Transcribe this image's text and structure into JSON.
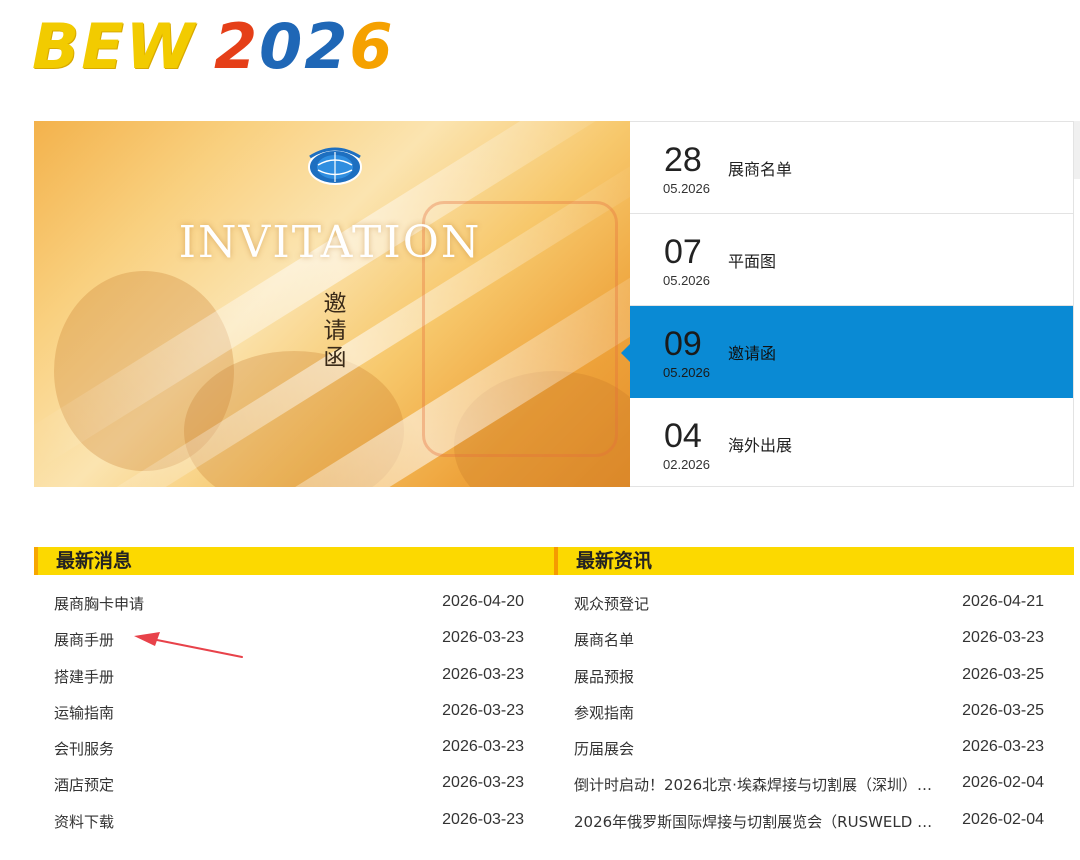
{
  "logo": {
    "bew": "BEW",
    "year_digits": [
      "2",
      "0",
      "2",
      "6"
    ]
  },
  "banner": {
    "title": "INVITATION",
    "subtitle": "邀请函"
  },
  "dates": [
    {
      "day": "28",
      "month_year": "05.2026",
      "title": "展商名单",
      "active": false
    },
    {
      "day": "07",
      "month_year": "05.2026",
      "title": "平面图",
      "active": false
    },
    {
      "day": "09",
      "month_year": "05.2026",
      "title": "邀请函",
      "active": true
    },
    {
      "day": "04",
      "month_year": "02.2026",
      "title": "海外出展",
      "active": false
    }
  ],
  "left_column": {
    "title": "最新消息",
    "items": [
      {
        "title": "展商胸卡申请",
        "date": "2026-04-20"
      },
      {
        "title": "展商手册",
        "date": "2026-03-23"
      },
      {
        "title": "搭建手册",
        "date": "2026-03-23"
      },
      {
        "title": "运输指南",
        "date": "2026-03-23"
      },
      {
        "title": "会刊服务",
        "date": "2026-03-23"
      },
      {
        "title": "酒店预定",
        "date": "2026-03-23"
      },
      {
        "title": "资料下载",
        "date": "2026-03-23"
      }
    ]
  },
  "right_column": {
    "title": "最新资讯",
    "items": [
      {
        "title": "观众预登记",
        "date": "2026-04-21"
      },
      {
        "title": "展商名单",
        "date": "2026-03-23"
      },
      {
        "title": "展品预报",
        "date": "2026-03-25"
      },
      {
        "title": "参观指南",
        "date": "2026-03-25"
      },
      {
        "title": "历届展会",
        "date": "2026-03-23"
      },
      {
        "title": "倒计时启动！2026北京·埃森焊接与切割展（深圳）…",
        "date": "2026-02-04"
      },
      {
        "title": "2026年俄罗斯国际焊接与切割展览会（RUSWELD …",
        "date": "2026-02-04"
      }
    ]
  },
  "colors": {
    "accent_blue": "#0a8ad4",
    "header_yellow": "#fcd900",
    "annotation_red": "#e8424a"
  }
}
